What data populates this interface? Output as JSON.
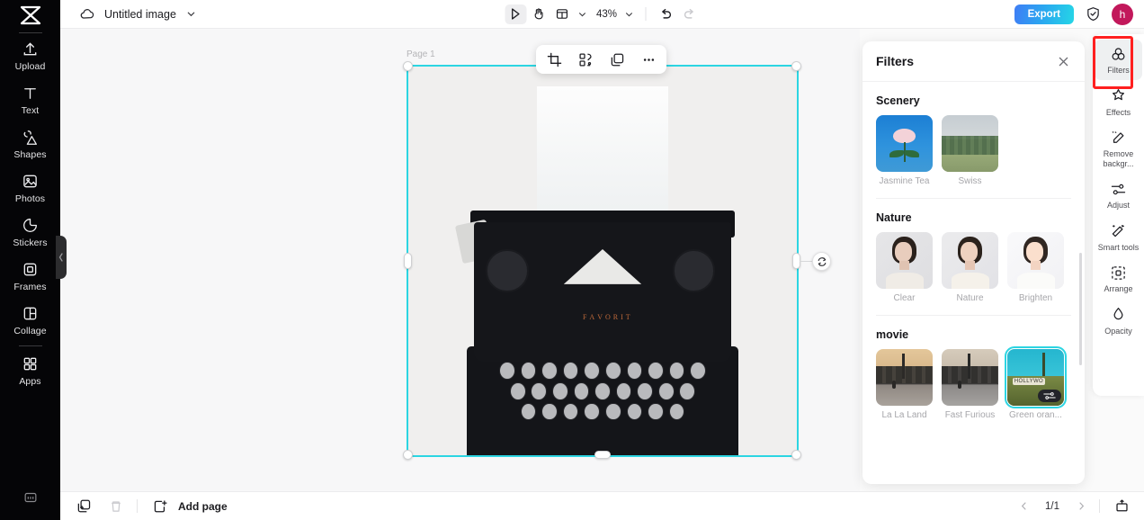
{
  "app": {
    "brand_icon": "capcut-logo-icon",
    "document_title": "Untitled image",
    "cloud_icon": "cloud-icon",
    "title_caret_icon": "chevron-down-icon"
  },
  "toolbar": {
    "select_icon": "cursor-select-icon",
    "hand_icon": "hand-pan-icon",
    "layout_icon": "page-layout-icon",
    "layout_caret_icon": "chevron-down-icon",
    "zoom_level": "43%",
    "zoom_caret_icon": "chevron-down-icon",
    "undo_icon": "undo-icon",
    "redo_icon": "redo-icon",
    "export_label": "Export",
    "shield_icon": "shield-check-icon",
    "avatar_initial": "h",
    "avatar_color": "#c2185b",
    "export_gradient_from": "#3f7df5",
    "export_gradient_to": "#25d6e6"
  },
  "sidebar": {
    "items": [
      {
        "label": "Upload",
        "icon": "upload-icon"
      },
      {
        "label": "Text",
        "icon": "text-t-icon"
      },
      {
        "label": "Shapes",
        "icon": "shapes-icon"
      },
      {
        "label": "Photos",
        "icon": "photo-image-icon"
      },
      {
        "label": "Stickers",
        "icon": "sticker-icon"
      },
      {
        "label": "Frames",
        "icon": "frame-icon"
      },
      {
        "label": "Collage",
        "icon": "collage-grid-icon"
      },
      {
        "label": "Apps",
        "icon": "apps-grid-icon"
      }
    ],
    "bottom_icon": "keyboard-shortcut-icon",
    "collapse_icon": "chevron-left-icon"
  },
  "canvas": {
    "page_label": "Page 1",
    "selection_color": "#2cd5e2",
    "rotate_icon": "rotate-icon",
    "typewriter_brand": [
      "F",
      "A",
      "V",
      "O",
      "R",
      "I",
      "T"
    ],
    "context_toolbar": [
      {
        "icon": "crop-icon",
        "name": "crop-button"
      },
      {
        "icon": "cutout-icon",
        "name": "cutout-button"
      },
      {
        "icon": "duplicate-icon",
        "name": "duplicate-button"
      },
      {
        "icon": "more-dots-icon",
        "name": "more-options-button"
      }
    ]
  },
  "filters_panel": {
    "title": "Filters",
    "close_icon": "close-icon",
    "groups": [
      {
        "title": "Scenery",
        "items": [
          {
            "label": "Jasmine Tea",
            "selected": false,
            "art": "rose"
          },
          {
            "label": "Swiss",
            "selected": false,
            "art": "swiss"
          }
        ]
      },
      {
        "title": "Nature",
        "items": [
          {
            "label": "Clear",
            "selected": false,
            "art": "portrait"
          },
          {
            "label": "Nature",
            "selected": false,
            "art": "portrait-warm"
          },
          {
            "label": "Brighten",
            "selected": false,
            "art": "portrait-bright"
          }
        ]
      },
      {
        "title": "movie",
        "items": [
          {
            "label": "La La Land",
            "selected": false,
            "art": "city"
          },
          {
            "label": "Fast Furious",
            "selected": false,
            "art": "city-gray"
          },
          {
            "label": "Green oran...",
            "selected": true,
            "art": "hollywood",
            "badge_icon": "adjust-sliders-icon"
          }
        ]
      }
    ]
  },
  "right_rail": {
    "highlight_color": "#ff1f1f",
    "items": [
      {
        "label": "Filters",
        "icon": "filters-circles-icon",
        "active": true
      },
      {
        "label": "Effects",
        "icon": "effects-star-icon",
        "active": false
      },
      {
        "label": "Remove backgr...",
        "icon": "remove-background-icon",
        "active": false
      },
      {
        "label": "Adjust",
        "icon": "adjust-sliders-icon",
        "active": false
      },
      {
        "label": "Smart tools",
        "icon": "magic-wand-icon",
        "active": false
      },
      {
        "label": "Arrange",
        "icon": "arrange-icon",
        "active": false
      },
      {
        "label": "Opacity",
        "icon": "opacity-drop-icon",
        "active": false
      }
    ]
  },
  "bottom_bar": {
    "duplicate_page_icon": "duplicate-page-icon",
    "delete_icon": "trash-icon",
    "add_page_icon": "add-page-icon",
    "add_page_label": "Add page",
    "prev_icon": "chevron-left-icon",
    "page_indicator": "1/1",
    "next_icon": "chevron-right-icon",
    "present_icon": "present-icon"
  }
}
